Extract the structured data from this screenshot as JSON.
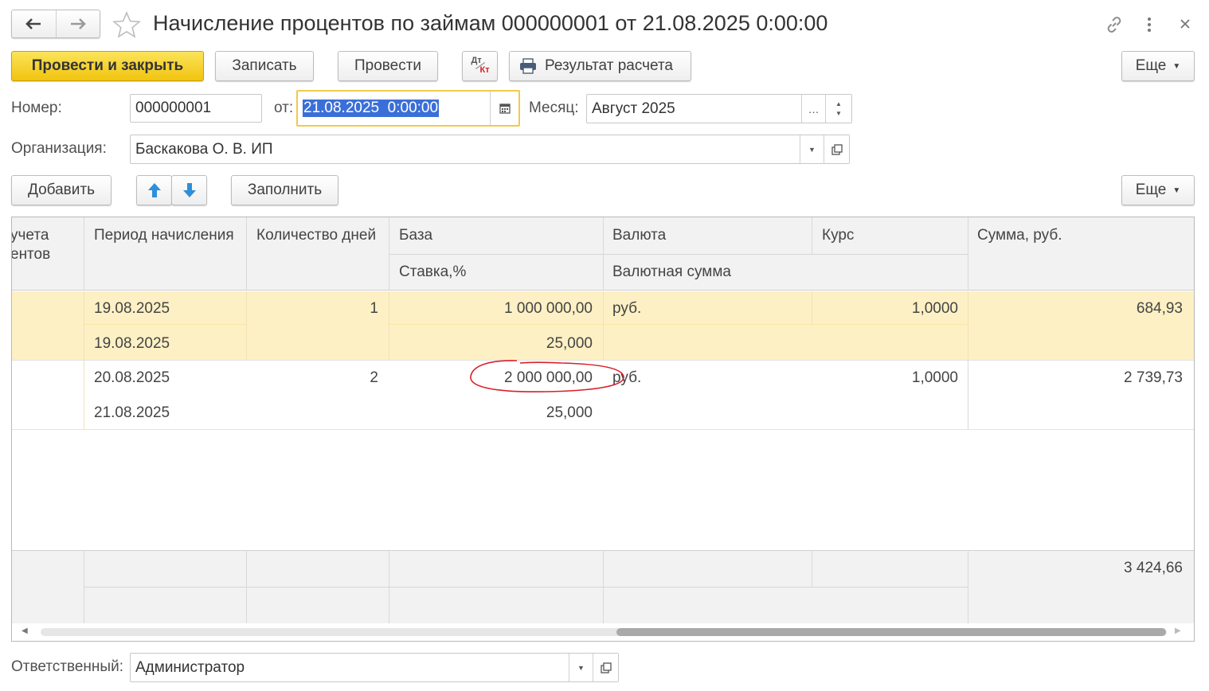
{
  "window": {
    "title": "Начисление процентов по займам 000000001 от 21.08.2025 0:00:00",
    "back_icon": "arrow-left-icon",
    "forward_icon": "arrow-right-icon",
    "favorite_icon": "star-icon",
    "link_icon": "link-icon",
    "more_icon": "vertical-dots-icon",
    "close_icon": "close-icon"
  },
  "toolbar": {
    "post_and_close": "Провести и закрыть",
    "save": "Записать",
    "post": "Провести",
    "dtkt_top": "Дт",
    "dtkt_bottom": "Кт",
    "calc_result": "Результат расчета",
    "more": "Еще"
  },
  "header": {
    "number_label": "Номер:",
    "number_value": "000000001",
    "date_label": "от:",
    "date_value": "21.08.2025  0:00:00",
    "month_label": "Месяц:",
    "month_value": "Август 2025",
    "org_label": "Организация:",
    "org_value": "Баскакова О. В. ИП"
  },
  "table_toolbar": {
    "add": "Добавить",
    "fill": "Заполнить",
    "more": "Еще"
  },
  "table": {
    "headers": {
      "col1_line1": "учета",
      "col1_line2": "ентов",
      "period": "Период начисления",
      "days": "Количество дней",
      "base": "База",
      "rate": "Ставка,%",
      "currency": "Валюта",
      "currency_sum": "Валютная сумма",
      "course": "Курс",
      "sum": "Сумма, руб."
    },
    "rows": [
      {
        "period_start": "19.08.2025",
        "period_end": "19.08.2025",
        "days": "1",
        "base": "1 000 000,00",
        "rate": "25,000",
        "currency": "руб.",
        "course": "1,0000",
        "sum": "684,93"
      },
      {
        "period_start": "20.08.2025",
        "period_end": "21.08.2025",
        "days": "2",
        "base": "2 000 000,00",
        "rate": "25,000",
        "currency": "руб.",
        "course": "1,0000",
        "sum": "2 739,73"
      }
    ],
    "total_sum": "3 424,66"
  },
  "footer": {
    "responsible_label": "Ответственный:",
    "responsible_value": "Администратор"
  },
  "colors": {
    "accent_yellow": "#f5d31f",
    "selected_row": "#fdf0c4",
    "annotation": "#d9202a",
    "date_focus": "#f2c94c",
    "selection_blue": "#3b6fd8"
  }
}
